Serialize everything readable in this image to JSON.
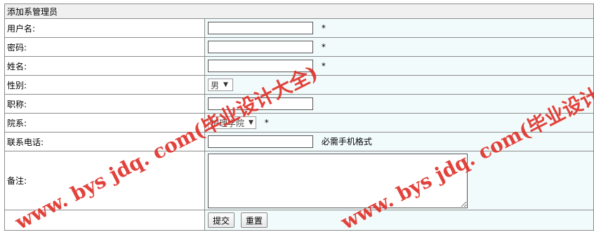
{
  "form": {
    "title": "添加系管理员",
    "fields": {
      "username": {
        "label": "用户名:",
        "value": "",
        "required": "*"
      },
      "password": {
        "label": "密码:",
        "value": "",
        "required": "*"
      },
      "realname": {
        "label": "姓名:",
        "value": "",
        "required": "*"
      },
      "gender": {
        "label": "性别:",
        "selected": "男"
      },
      "jobtitle": {
        "label": "职称:",
        "value": ""
      },
      "department": {
        "label": "院系:",
        "selected": "护理学院",
        "required": "*"
      },
      "phone": {
        "label": "联系电话:",
        "value": "",
        "hint": "必需手机格式"
      },
      "remark": {
        "label": "备注:",
        "value": ""
      }
    },
    "buttons": {
      "submit": "提交",
      "reset": "重置"
    }
  },
  "watermark": {
    "text_left": "www. bys jdq. com(毕业设计大全)",
    "text_right": "www. bys jdq. com(毕业设计大全)",
    "color": "#e0332b"
  },
  "icons": {
    "select_arrow": "dropdown-arrow-icon"
  }
}
